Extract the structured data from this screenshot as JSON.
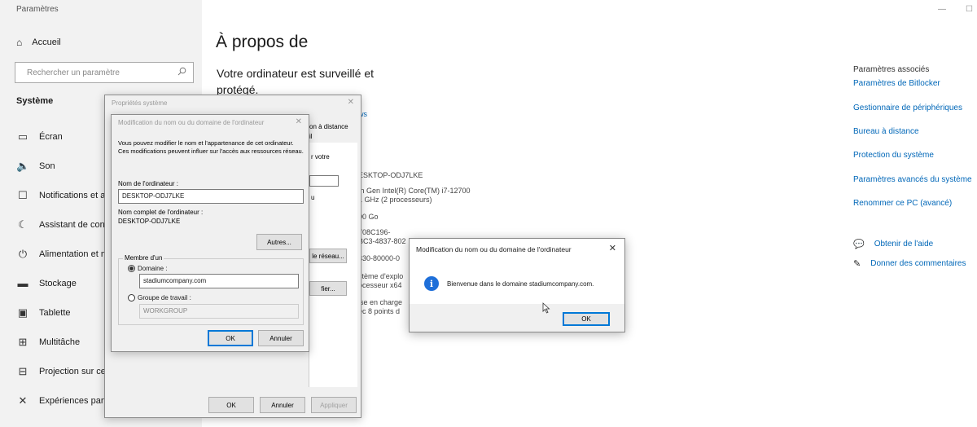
{
  "window": {
    "title": "Paramètres",
    "minimize": "—",
    "maximize": "☐"
  },
  "sidebar": {
    "home_label": "Accueil",
    "search_placeholder": "Rechercher un paramètre",
    "section": "Système",
    "items": [
      {
        "label": "Écran",
        "icon": "monitor-icon"
      },
      {
        "label": "Son",
        "icon": "speaker-icon"
      },
      {
        "label": "Notifications et act",
        "icon": "notification-icon"
      },
      {
        "label": "Assistant de conce",
        "icon": "focus-assist-icon"
      },
      {
        "label": "Alimentation et mi",
        "icon": "power-icon"
      },
      {
        "label": "Stockage",
        "icon": "storage-icon"
      },
      {
        "label": "Tablette",
        "icon": "tablet-icon"
      },
      {
        "label": "Multitâche",
        "icon": "multitask-icon"
      },
      {
        "label": "Projection sur ce P",
        "icon": "projection-icon"
      },
      {
        "label": "Expériences partag",
        "icon": "shared-experiences-icon"
      }
    ]
  },
  "main": {
    "title": "À propos de",
    "subtitle": "Votre ordinateur est surveillé et protégé.",
    "fragments": {
      "link_ws": "ws",
      "device_name": "ESKTOP-ODJ7LKE",
      "processor_1": "th Gen Intel(R) Core(TM) i7-12700",
      "processor_2": "1 GHz  (2 processeurs)",
      "ram": "00 Go",
      "id_1": "708C196-",
      "id_2": "BC3-4837-802",
      "id_3": "330-80000-0",
      "type_1": "stème d'explo",
      "type_2": "ocesseur x64",
      "pen_1": "ise en charge",
      "pen_2": "ec 8 points d"
    }
  },
  "related": {
    "title": "Paramètres associés",
    "links": [
      "Paramètres de Bitlocker",
      "Gestionnaire de périphériques",
      "Bureau à distance",
      "Protection du système",
      "Paramètres avancés du système",
      "Renommer ce PC (avancé)"
    ],
    "help": "Obtenir de l'aide",
    "feedback": "Donner des commentaires"
  },
  "system_props": {
    "title": "Propriétés système",
    "tab_remote": "on à distance",
    "tab_remote_2": "il",
    "frag_votre": "r votre",
    "frag_u": "u",
    "frag_reseau": "le réseau...",
    "frag_fier": "fier...",
    "ok": "OK",
    "cancel": "Annuler",
    "apply": "Appliquer",
    "close": "✕"
  },
  "rename_dialog": {
    "title": "Modification du nom ou du domaine de l'ordinateur",
    "close": "✕",
    "intro": "Vous pouvez modifier le nom et l'appartenance de cet ordinateur. Ces modifications peuvent influer sur l'accès aux ressources réseau.",
    "computer_name_label": "Nom de l'ordinateur :",
    "computer_name_value": "DESKTOP-ODJ7LKE",
    "full_name_label": "Nom complet de l'ordinateur :",
    "full_name_value": "DESKTOP-ODJ7LKE",
    "more_button": "Autres...",
    "member_of": "Membre d'un",
    "domain_label": "Domaine :",
    "domain_value": "stadiumcompany.com",
    "workgroup_label": "Groupe de travail :",
    "workgroup_value": "WORKGROUP",
    "ok": "OK",
    "cancel": "Annuler"
  },
  "welcome_dialog": {
    "title": "Modification du nom ou du domaine de l'ordinateur",
    "close": "✕",
    "icon_glyph": "i",
    "message": "Bienvenue dans le domaine stadiumcompany.com.",
    "ok": "OK"
  }
}
